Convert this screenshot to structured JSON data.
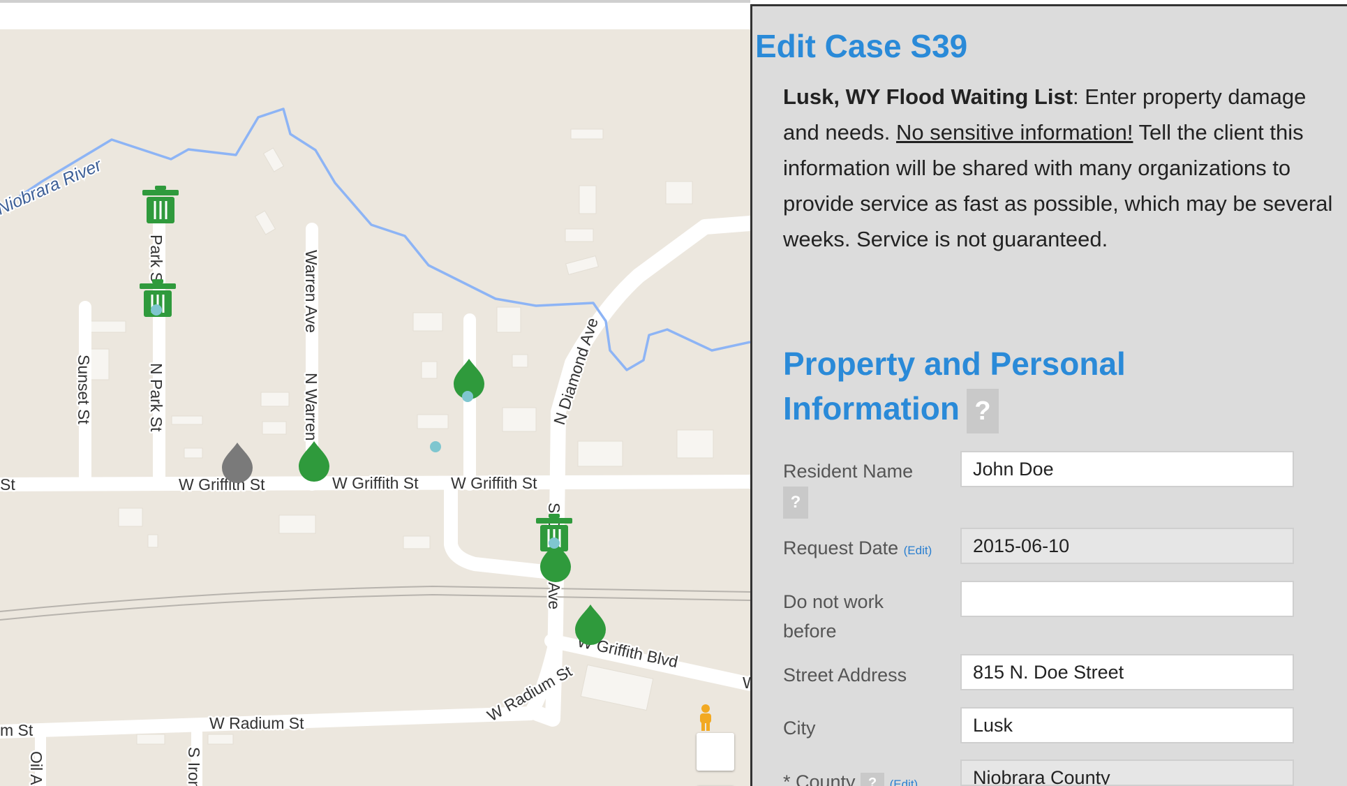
{
  "map": {
    "river_label": "Niobrara River",
    "street_labels": {
      "w_griffith_1": "W Griffith St",
      "w_griffith_2": "W Griffith St",
      "w_griffith_3": "W Griffith St",
      "st_left": "St",
      "park_st_top": "Park S",
      "n_park_st": "N Park St",
      "sunset_st": "Sunset St",
      "warren_ave": "Warren Ave",
      "n_warren": "N Warren",
      "n_diamond_ave": "N Diamond Ave",
      "s_diamond_top": "S D",
      "ave_lower": "Ave",
      "w_griffith_blvd": "W Griffith Blvd",
      "w_radium_st": "W Radium St",
      "w_radium_diag": "W Radium St",
      "m_st": "m St",
      "oil_a": "Oil A",
      "s_iron": "S Iron",
      "w_edge": "W"
    },
    "controls": {
      "pegman": "pegman-icon",
      "zoom_in": "+"
    },
    "colors": {
      "land": "#ece7de",
      "road": "#ffffff",
      "river": "#8db4f5",
      "marker_green": "#2f9a3c",
      "marker_gray": "#7a7a7a"
    }
  },
  "panel": {
    "title": "Edit Case S39",
    "intro": {
      "bold": "Lusk, WY Flood Waiting List",
      "part1": ": Enter property damage and needs. ",
      "underline": "No sensitive information!",
      "part2": " Tell the client this information will be shared with many organizations to provide service as fast as possible, which may be several weeks. Service is not guaranteed."
    },
    "section_title": "Property and Personal Information",
    "help_symbol": "?",
    "fields": {
      "resident_name": {
        "label": "Resident Name",
        "value": "John Doe"
      },
      "request_date": {
        "label": "Request Date",
        "edit": "(Edit)",
        "value": "2015-06-10"
      },
      "do_not_work_before": {
        "label": "Do not work before",
        "value": ""
      },
      "street_address": {
        "label": "Street Address",
        "value": "815 N. Doe Street"
      },
      "city": {
        "label": "City",
        "value": "Lusk"
      },
      "county": {
        "label": "* County",
        "edit": "(Edit)",
        "value": "Niobrara County"
      }
    },
    "colors": {
      "heading": "#2a8ad8",
      "panel_bg": "#dcdcdc"
    }
  }
}
